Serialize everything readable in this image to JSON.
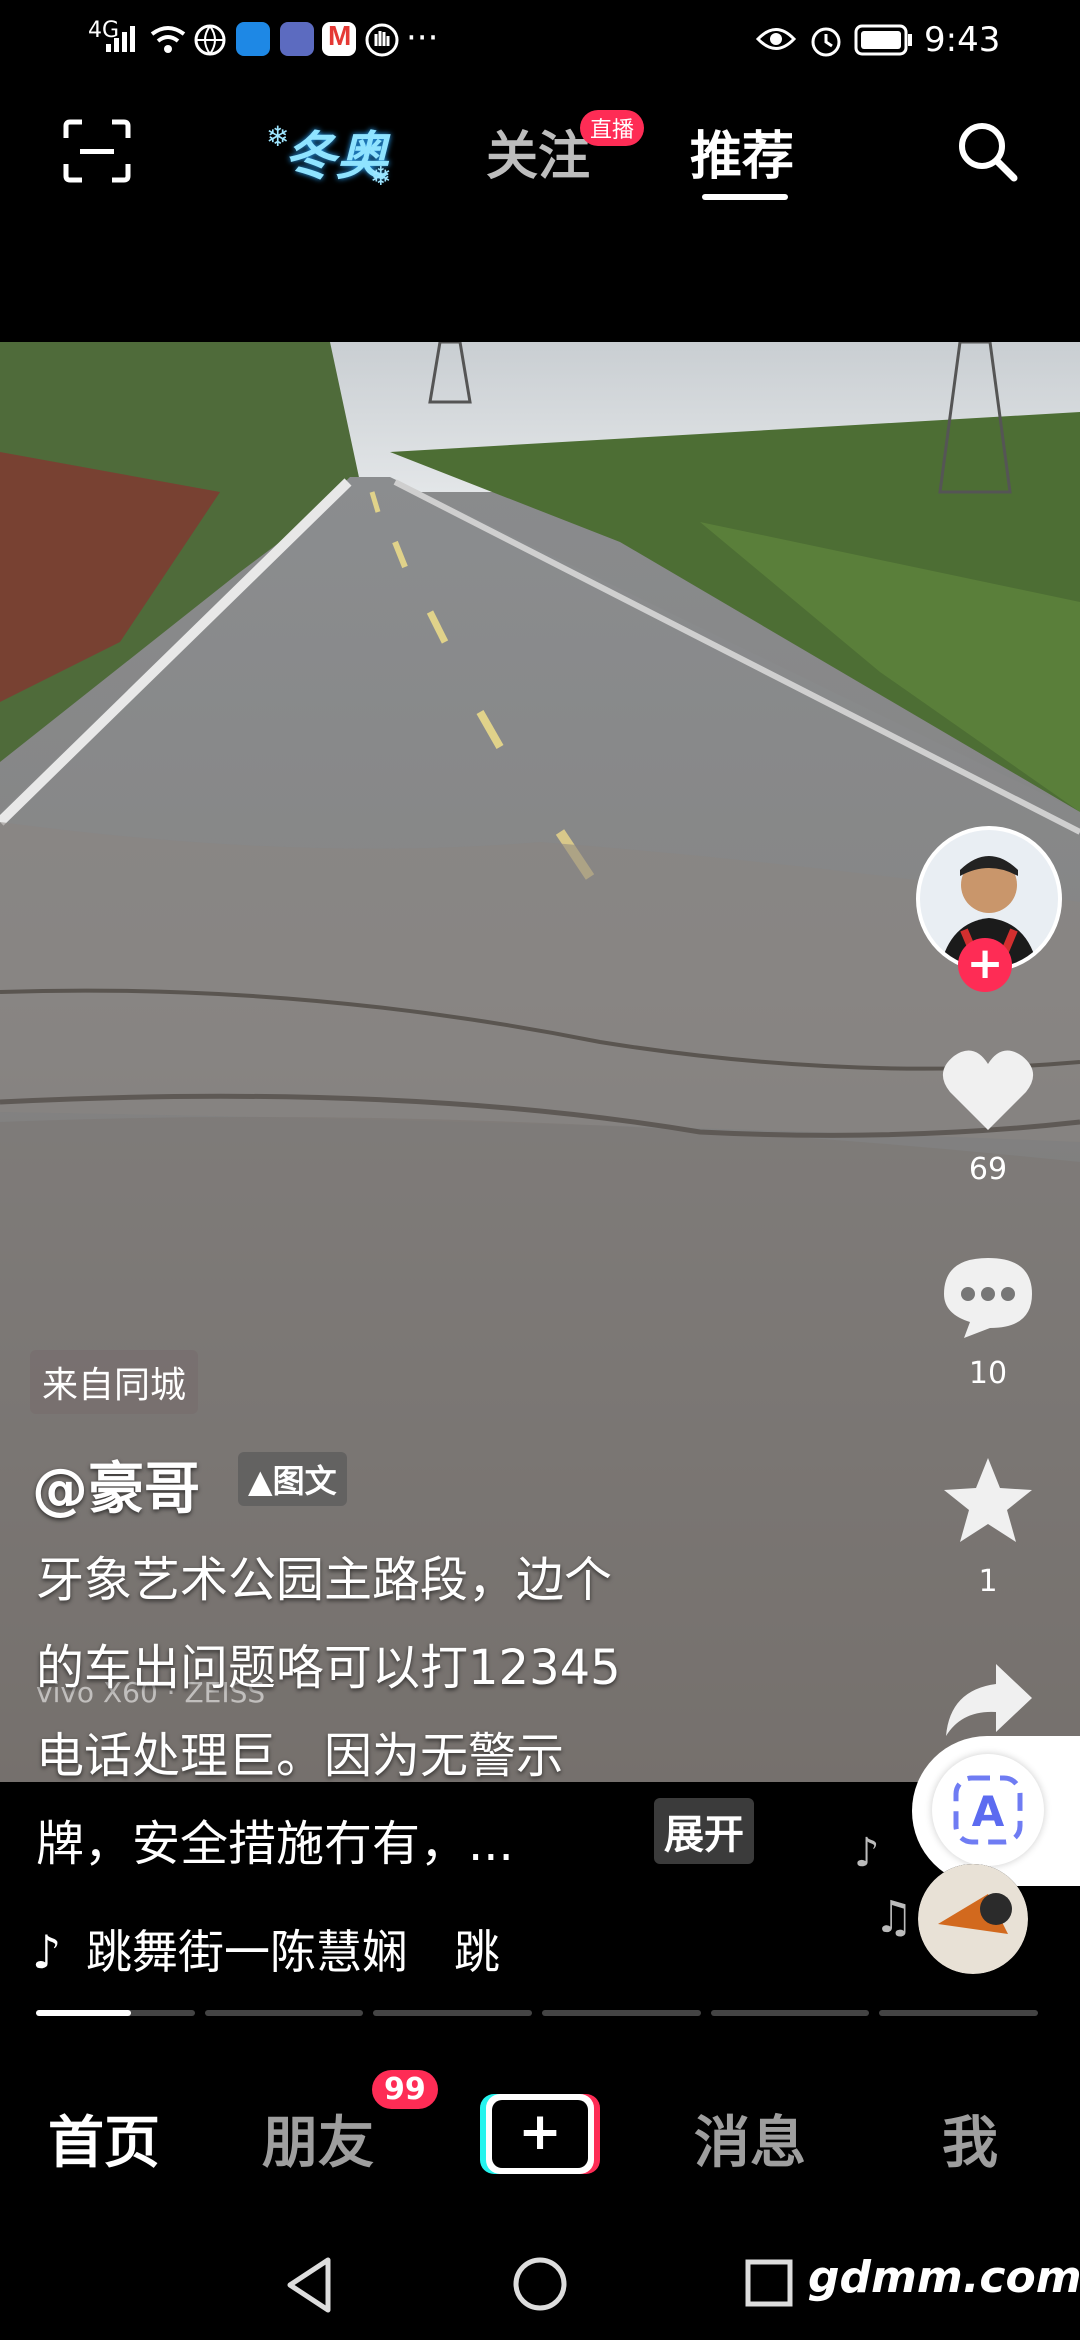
{
  "status_bar": {
    "network": "4G",
    "time": "9:43",
    "more": "···"
  },
  "top_nav": {
    "winter_olympics": "冬奥",
    "follow": "关注",
    "live_badge": "直播",
    "recommend": "推荐"
  },
  "post": {
    "location_tag": "来自同城",
    "author": "@豪哥",
    "type_tag": "图文",
    "caption_lines": [
      "牙象艺术公园主路段，边个",
      "的车出问题咯可以打12345",
      "电话处理巨。因为无警示",
      "牌，安全措施冇有，..."
    ],
    "expand": "展开",
    "watermark": "vivo X60 · ZEISS",
    "music": "跳舞街一陈慧娴　跳"
  },
  "actions": {
    "likes": "69",
    "comments": "10",
    "favorites": "1"
  },
  "progress": {
    "segments": 6,
    "active_fraction": 0.6
  },
  "bottom_nav": {
    "home": "首页",
    "friends": "朋友",
    "friends_badge": "99",
    "add": "+",
    "messages": "消息",
    "me": "我"
  },
  "system_nav": {
    "watermark": "gdmm.com"
  },
  "colors": {
    "accent_red": "#fe2c55",
    "cyan": "#25f4ee",
    "background": "#000000"
  },
  "icons": [
    "scan-icon",
    "search-icon",
    "heart-icon",
    "comment-icon",
    "star-icon",
    "share-icon",
    "translate-icon",
    "music-note-icon",
    "back-icon",
    "home-circle-icon",
    "recents-square-icon"
  ]
}
